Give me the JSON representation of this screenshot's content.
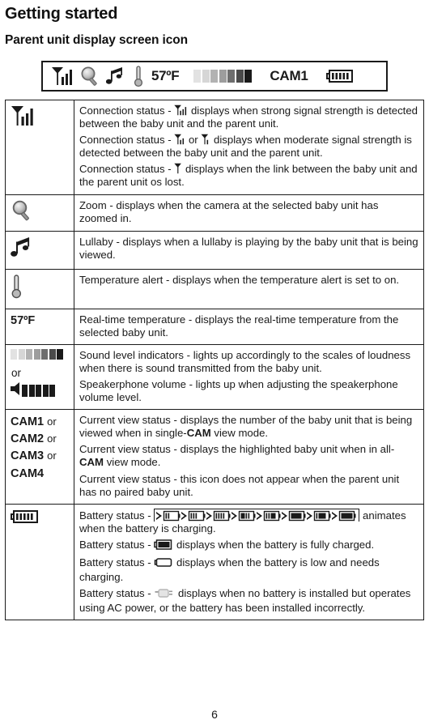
{
  "page": {
    "title": "Getting started",
    "section_title": "Parent unit display screen icon",
    "page_number": "6"
  },
  "display_strip": {
    "icons": [
      "signal-strength-icon",
      "zoom-magnifier-icon",
      "lullaby-music-note-icon",
      "thermometer-icon"
    ],
    "temperature": "57ºF",
    "sound_level_icon": "sound-level-bars-icon",
    "camera_label": "CAM1",
    "battery_icon": "battery-full-icon"
  },
  "table": {
    "rows": [
      {
        "icon": "signal-strength-icon",
        "lines": [
          {
            "pre": "Connection status - ",
            "icon": "signal-strong-icon",
            "post": " displays when strong signal strength is detected between the baby unit and the parent unit."
          },
          {
            "pre": "Connection status - ",
            "icon": "signal-medium-icon",
            "mid": " or ",
            "icon2": "signal-weak-icon",
            "post": " displays when moderate signal strength is detected between the baby unit and the parent unit."
          },
          {
            "pre": "Connection status - ",
            "icon": "signal-none-icon",
            "post": " displays when the link between the baby unit and the parent unit os lost."
          }
        ]
      },
      {
        "icon": "zoom-magnifier-icon",
        "lines": [
          {
            "text": "Zoom - displays when the camera at the selected baby unit has zoomed in."
          }
        ]
      },
      {
        "icon": "lullaby-music-note-icon",
        "lines": [
          {
            "text": "Lullaby - displays when a lullaby is playing by the baby unit that is being viewed."
          }
        ]
      },
      {
        "icon": "thermometer-icon",
        "lines": [
          {
            "text": "Temperature alert - displays when the temperature alert is set to on."
          }
        ]
      },
      {
        "icon_text": "57ºF",
        "lines": [
          {
            "text": "Real-time temperature - displays the real-time temperature from the selected baby unit."
          }
        ]
      },
      {
        "icon": "sound-level-bars-icon",
        "or_word": "or",
        "icon_alt": "speakerphone-volume-icon",
        "lines": [
          {
            "text": "Sound level indicators - lights up accordingly to the scales of loudness when there is sound transmitted from the baby unit."
          },
          {
            "text": "Speakerphone volume - lights up when adjusting the speakerphone volume level."
          }
        ]
      },
      {
        "cam_labels": [
          "CAM1",
          "CAM2",
          "CAM3",
          "CAM4"
        ],
        "or_label": "or",
        "lines": [
          {
            "pre": "Current view status - displays the number of the baby unit that is being viewed when in single-",
            "bold": "CAM",
            "post": " view mode."
          },
          {
            "pre": "Current view status - displays the highlighted baby unit when in all-",
            "bold": "CAM",
            "post": " view mode."
          },
          {
            "text": "Current view status - this icon does not appear when the parent unit has no paired baby unit."
          }
        ]
      },
      {
        "icon": "battery-full-icon",
        "lines": [
          {
            "pre": "Battery status - ",
            "icon": "battery-charging-animation-icon",
            "post": " animates when the battery is charging."
          },
          {
            "pre": "Battery status - ",
            "icon": "battery-full-small-icon",
            "post": " displays when the battery is fully charged."
          },
          {
            "pre": "Battery status - ",
            "icon": "battery-empty-icon",
            "post": " displays when the battery is low and needs charging."
          },
          {
            "pre": "Battery status - ",
            "icon": "battery-none-icon",
            "post": " displays when no battery is installed but operates using AC power, or the battery has been installed incorrectly."
          }
        ]
      }
    ]
  },
  "colors": {
    "ink": "#1a1a1a",
    "sound_bar_1": "#e0e0e0",
    "sound_bar_2": "#d2d2d2",
    "sound_bar_3": "#b0b0b0",
    "sound_bar_4": "#9a9a9a",
    "sound_bar_5": "#6e6e6e",
    "sound_bar_6": "#4a4a4a",
    "sound_bar_7": "#1a1a1a"
  }
}
